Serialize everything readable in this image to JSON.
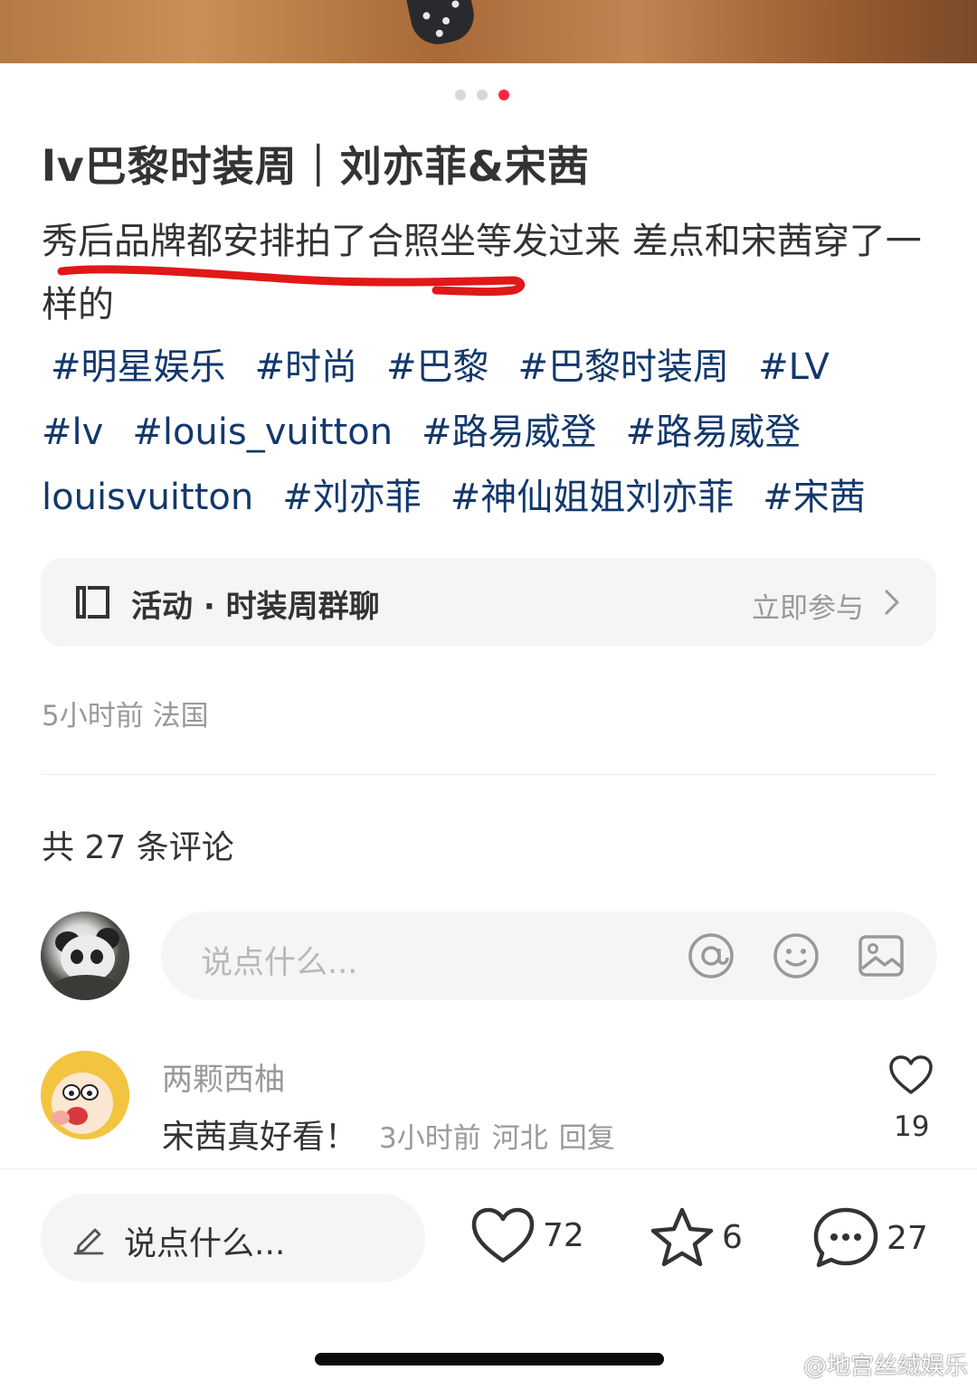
{
  "carousel": {
    "count": 3,
    "active_index": 2
  },
  "post": {
    "title": "lv巴黎时装周｜刘亦菲&宋茜",
    "description": "秀后品牌都安排拍了合照坐等发过来 差点和宋茜穿了一样的",
    "tags": [
      "#明星娱乐",
      "#时尚",
      "#巴黎",
      "#巴黎时装周",
      "#LV",
      "#lv",
      "#louis_vuitton",
      "#路易威登",
      "#路易威登",
      "louisvuitton",
      "#刘亦菲",
      "#神仙姐姐刘亦菲",
      "#宋茜"
    ],
    "meta": "5小时前 法国"
  },
  "activity": {
    "label": "活动 · 时装周群聊",
    "action": "立即参与"
  },
  "comments": {
    "count_label": "共 27 条评论",
    "input_placeholder": "说点什么...",
    "items": [
      {
        "user": "两颗西柚",
        "text": "宋茜真好看！",
        "time": "3小时前",
        "location": "河北",
        "reply": "回复",
        "likes": "19"
      }
    ]
  },
  "bottom_bar": {
    "input_placeholder": "说点什么...",
    "likes": "72",
    "favorites": "6",
    "comments": "27"
  },
  "watermark": "@地宫丝绒娱乐",
  "colors": {
    "accent": "#ff2442",
    "tag": "#13386c",
    "muted": "#999999",
    "text": "#333333",
    "pill": "#f5f5f5"
  },
  "icons": {
    "at": "at-icon",
    "emoji": "emoji-icon",
    "image": "image-icon",
    "like": "heart-icon",
    "favorite": "star-icon",
    "comment": "comment-icon",
    "edit": "pencil-icon",
    "activity": "activity-icon",
    "chevron": "chevron-right-icon"
  }
}
